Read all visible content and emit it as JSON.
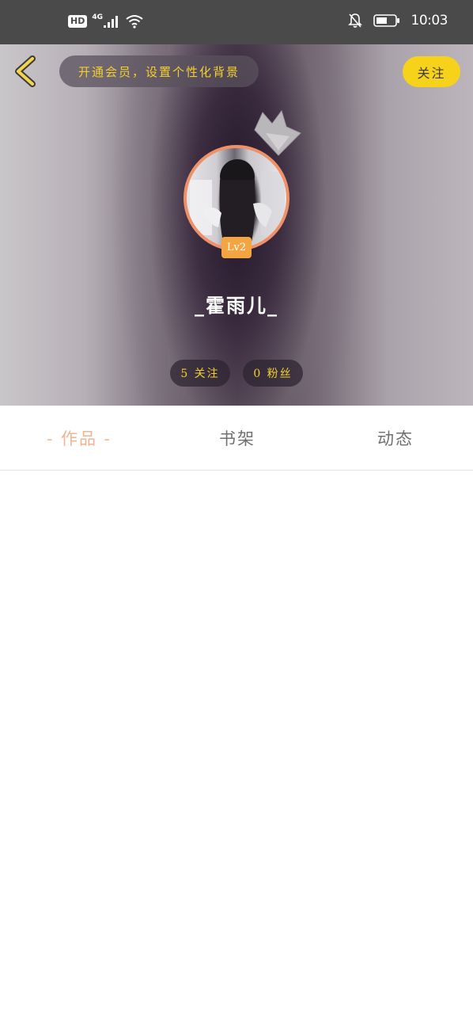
{
  "status_bar": {
    "hd": "HD",
    "network": "4G",
    "time": "10:03",
    "icons": [
      "signal-icon",
      "wifi-icon",
      "mute-bell-icon",
      "battery-icon"
    ]
  },
  "header": {
    "vip_banner": "开通会员，设置个性化背景",
    "follow_label": "关注",
    "level": "Lv2",
    "nickname": "_霍雨儿_",
    "following": "5 关注",
    "fans": "0 粉丝",
    "accent": "#f7d21a"
  },
  "tabs": {
    "works": "- 作品 -",
    "shelf": "书架",
    "dynamic": "动态",
    "active_color": "#f0b493"
  }
}
